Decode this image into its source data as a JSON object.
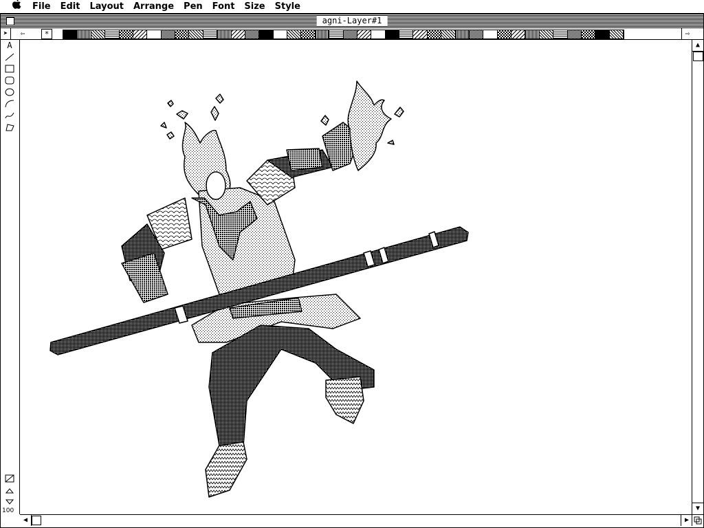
{
  "menubar": {
    "apple_glyph": "",
    "items": [
      "File",
      "Edit",
      "Layout",
      "Arrange",
      "Pen",
      "Font",
      "Size",
      "Style"
    ]
  },
  "window": {
    "title": "agni-Layer#1"
  },
  "patternbar": {
    "none_glyph": "*"
  },
  "toolbox": {
    "text_tool_label": "A",
    "zoom_level": "100"
  },
  "colors": {
    "ink": "#000000",
    "paper": "#ffffff"
  }
}
